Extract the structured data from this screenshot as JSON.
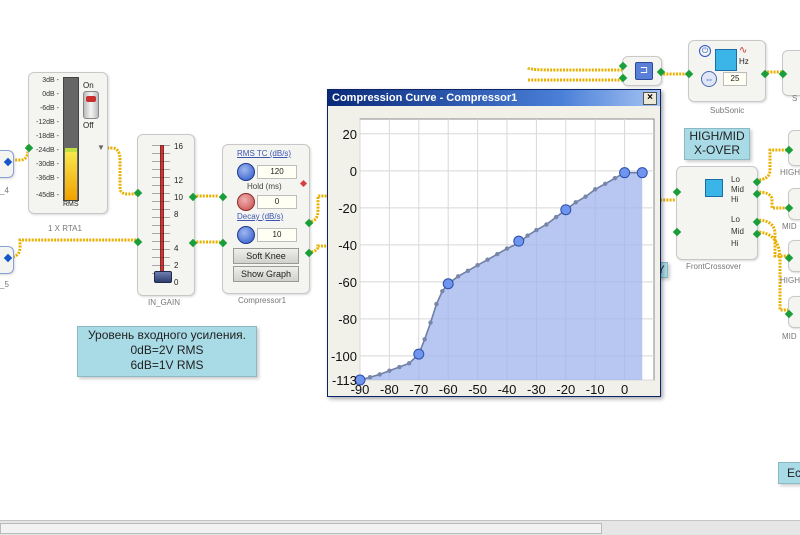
{
  "rta": {
    "scale": [
      "3dB -",
      "0dB -",
      "-6dB -",
      "-12dB -",
      "-18dB -",
      "-24dB -",
      "-30dB -",
      "-36dB -",
      "-45dB -"
    ],
    "on_label": "On",
    "off_label": "Off",
    "rms_label": "RMS",
    "block_label": "1 X RTA1"
  },
  "in_gain": {
    "scale": [
      "16",
      "12",
      "10",
      "8",
      "4",
      "2",
      "0"
    ],
    "block_label": "IN_GAIN"
  },
  "compressor": {
    "rms_tc_label": "RMS TC (dB/s)",
    "rms_tc_value": "120",
    "hold_label": "Hold (ms)",
    "hold_value": "0",
    "decay_label": "Decay (dB/s)",
    "decay_value": "10",
    "soft_knee_button": "Soft Knee",
    "show_graph_button": "Show Graph",
    "block_label": "Compressor1"
  },
  "left_labels": {
    "top": "_4",
    "bottom": "_5"
  },
  "note": {
    "line1": "Уровень входного усиления.",
    "line2": "0dB=2V RMS",
    "line3": "6dB=1V RMS"
  },
  "subsonic": {
    "hz_label": "Hz",
    "value": "25",
    "block_label": "SubSonic"
  },
  "highmid_label": {
    "line1": "HIGH/MID",
    "line2": "X-OVER"
  },
  "crossover": {
    "ch1": [
      "Lo",
      "Mid",
      "Hi"
    ],
    "ch2": [
      "Lo",
      "Mid",
      "Hi"
    ],
    "block_label": "FrontCrossover"
  },
  "right_partials": {
    "high": "HIGH",
    "mid": "MID",
    "high2": "HIGH",
    "mid2": "MID",
    "ec": "Ec",
    "y": "Y",
    "top_right": "S"
  },
  "graph_window": {
    "title": "Compression Curve - Compressor1",
    "close": "×"
  },
  "chart_data": {
    "type": "area",
    "title": "",
    "xlabel": "",
    "ylabel": "",
    "xlim": [
      -90,
      10
    ],
    "ylim": [
      -113,
      28
    ],
    "x_ticks": [
      -90,
      -80,
      -70,
      -60,
      -50,
      -40,
      -30,
      -20,
      -10,
      0
    ],
    "y_ticks": [
      20,
      0,
      -20,
      -40,
      -60,
      -80,
      -100,
      -113
    ],
    "grid": true,
    "fill_color": "#9fb4ee",
    "line_color": "#6e7fa6",
    "points": [
      [
        -90,
        -113
      ],
      [
        -86.6,
        -111.5
      ],
      [
        -83.3,
        -110
      ],
      [
        -80,
        -108
      ],
      [
        -76.6,
        -106
      ],
      [
        -73.3,
        -104
      ],
      [
        -70,
        -99
      ],
      [
        -68,
        -91
      ],
      [
        -66,
        -82
      ],
      [
        -64,
        -72
      ],
      [
        -62,
        -65
      ],
      [
        -60,
        -61
      ],
      [
        -56.6,
        -57
      ],
      [
        -53.3,
        -54
      ],
      [
        -50,
        -51
      ],
      [
        -46.6,
        -48
      ],
      [
        -43.3,
        -45
      ],
      [
        -40,
        -42
      ],
      [
        -36,
        -39
      ],
      [
        -33,
        -35
      ],
      [
        -30,
        -32
      ],
      [
        -26.6,
        -29
      ],
      [
        -23.3,
        -25
      ],
      [
        -20,
        -21
      ],
      [
        -16.6,
        -17
      ],
      [
        -13.3,
        -14
      ],
      [
        -10,
        -10
      ],
      [
        -6.6,
        -7
      ],
      [
        -3.3,
        -4
      ],
      [
        0,
        -1
      ],
      [
        6,
        -1
      ]
    ],
    "control_points": [
      [
        -90,
        -113
      ],
      [
        -70,
        -99
      ],
      [
        -60,
        -61
      ],
      [
        -36,
        -38
      ],
      [
        -20,
        -21
      ],
      [
        0,
        -1
      ],
      [
        6,
        -1
      ]
    ]
  },
  "colors": {
    "wire": "#e8b000",
    "pin": "#1a9e3a",
    "note_bg": "#a9dbe6",
    "title_bar": "#0a2a7a"
  }
}
